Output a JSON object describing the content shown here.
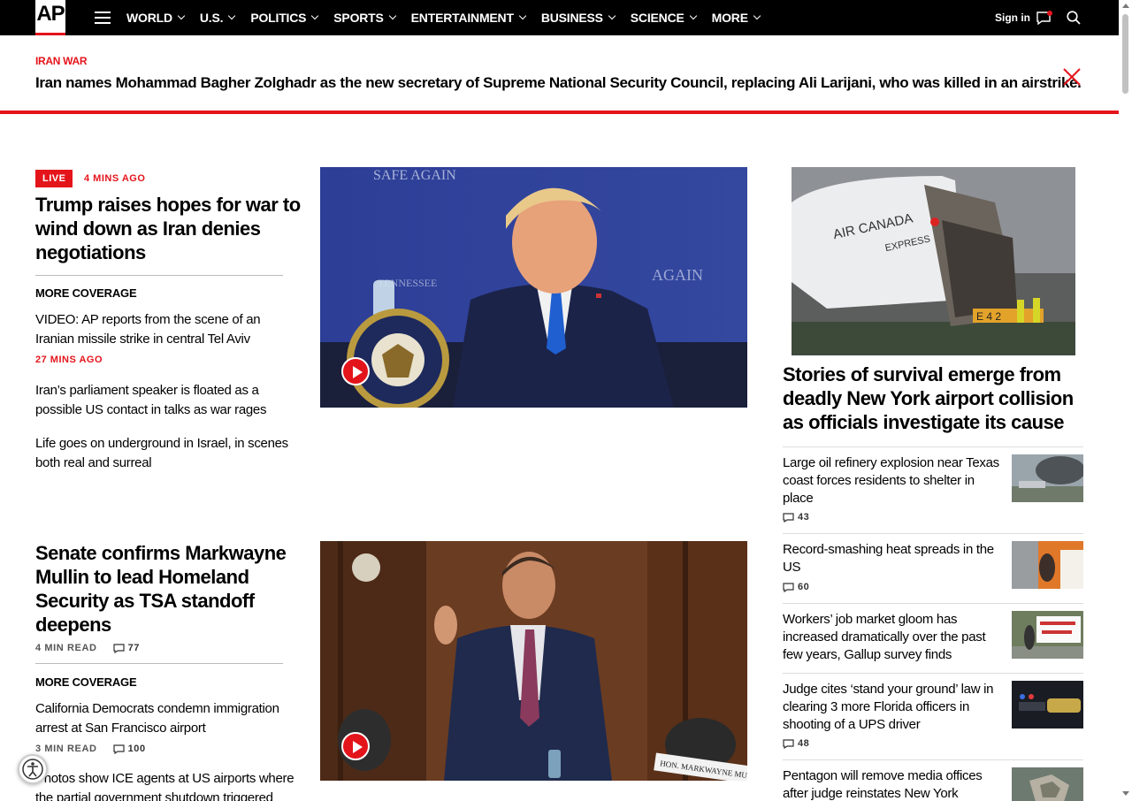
{
  "brand": {
    "logo_text": "AP"
  },
  "nav": {
    "items": [
      {
        "label": "WORLD"
      },
      {
        "label": "U.S."
      },
      {
        "label": "POLITICS"
      },
      {
        "label": "SPORTS"
      },
      {
        "label": "ENTERTAINMENT"
      },
      {
        "label": "BUSINESS"
      },
      {
        "label": "SCIENCE"
      },
      {
        "label": "MORE"
      }
    ],
    "signin": "Sign in"
  },
  "banner": {
    "kicker": "IRAN WAR",
    "headline": "Iran names Mohammad Bagher Zolghadr as the new secretary of Supreme National Security Council, replacing Ali Larijani, who was killed in an airstrike."
  },
  "story1": {
    "live": "LIVE",
    "time": "4 MINS AGO",
    "headline": "Trump raises hopes for war to wind down as Iran denies negotiations",
    "more_coverage": "MORE COVERAGE",
    "links": [
      {
        "text": "VIDEO: AP reports from the scene of an Iranian missile strike in central Tel Aviv",
        "time": "27 MINS AGO"
      },
      {
        "text": "Iran’s parliament speaker is floated as a possible US contact in talks as war rages"
      },
      {
        "text": "Life goes on underground in Israel, in scenes both real and surreal"
      }
    ]
  },
  "story2": {
    "headline": "Senate confirms Markwayne Mullin to lead Homeland Security as TSA standoff deepens",
    "read": "4 MIN READ",
    "comments": "77",
    "more_coverage": "MORE COVERAGE",
    "links": [
      {
        "text": "California Democrats condemn immigration arrest at San Francisco airport",
        "read": "3 MIN READ",
        "comments": "100"
      },
      {
        "text": "Photos show ICE agents at US airports where the partial government shutdown triggered"
      }
    ]
  },
  "right": {
    "headline": "Stories of survival emerge from deadly New York airport collision as officials investigate its cause",
    "items": [
      {
        "title": "Large oil refinery explosion near Texas coast forces residents to shelter in place",
        "comments": "43"
      },
      {
        "title": "Record-smashing heat spreads in the US",
        "comments": "60"
      },
      {
        "title": "Workers’ job market gloom has increased dramatically over the past few years, Gallup survey finds"
      },
      {
        "title": "Judge cites ‘stand your ground’ law in clearing 3 more Florida officers in shooting of a UPS driver",
        "comments": "48"
      },
      {
        "title": "Pentagon will remove media offices after judge reinstates New York"
      }
    ]
  },
  "colors": {
    "accent": "#e4141b",
    "nav_bg": "#000000"
  }
}
